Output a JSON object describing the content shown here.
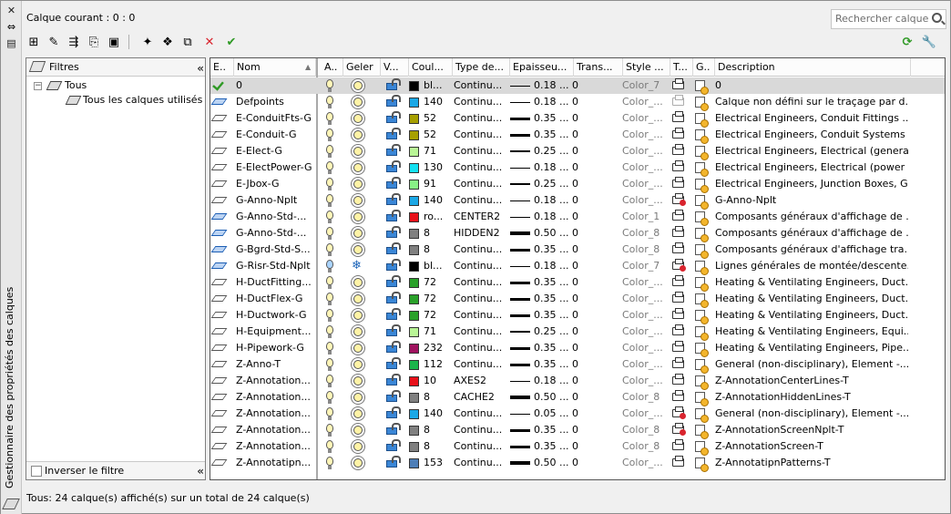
{
  "title": "Gestionnaire des propriétés des calques",
  "current_layer": "Calque courant : 0 : 0",
  "search": {
    "placeholder": "Rechercher calque"
  },
  "filters": {
    "header": "Filtres",
    "tree": [
      {
        "label": "Tous",
        "expanded": true
      },
      {
        "label": "Tous les calques utilisés"
      }
    ],
    "invert_label": "Inverser le filtre"
  },
  "columns": [
    "E..",
    "Nom",
    "A..",
    "Geler",
    "V...",
    "Coul...",
    "Type de...",
    "Epaisseu...",
    "Trans...",
    "Style ...",
    "T...",
    "G..",
    "Description"
  ],
  "rows": [
    {
      "state": "current",
      "name": "0",
      "on": true,
      "freeze": false,
      "color_hex": "#000000",
      "color": "bl...",
      "linetype": "Continu...",
      "lw_label": "0.18 ...",
      "lw": 1,
      "trans": "0",
      "style": "Color_7",
      "plot": "yes",
      "desc": "0"
    },
    {
      "state": "blue",
      "name": "Defpoints",
      "on": true,
      "freeze": false,
      "color_hex": "#1ba8e6",
      "color": "140",
      "linetype": "Continu...",
      "lw_label": "0.18 ...",
      "lw": 1,
      "trans": "0",
      "style": "Color_...",
      "plot": "dim",
      "desc": "Calque non défini sur le traçage par d..."
    },
    {
      "state": "gray",
      "name": "E-ConduitFts-G",
      "on": true,
      "freeze": false,
      "color_hex": "#a7a000",
      "color": "52",
      "linetype": "Continu...",
      "lw_label": "0.35 ...",
      "lw": 3,
      "trans": "0",
      "style": "Color_...",
      "plot": "yes",
      "desc": "Electrical Engineers, Conduit Fittings ..."
    },
    {
      "state": "gray",
      "name": "E-Conduit-G",
      "on": true,
      "freeze": false,
      "color_hex": "#a7a000",
      "color": "52",
      "linetype": "Continu...",
      "lw_label": "0.35 ...",
      "lw": 3,
      "trans": "0",
      "style": "Color_...",
      "plot": "yes",
      "desc": "Electrical Engineers, Conduit Systems ..."
    },
    {
      "state": "gray",
      "name": "E-Elect-G",
      "on": true,
      "freeze": false,
      "color_hex": "#b9f596",
      "color": "71",
      "linetype": "Continu...",
      "lw_label": "0.25 ...",
      "lw": 2,
      "trans": "0",
      "style": "Color_...",
      "plot": "yes",
      "desc": "Electrical Engineers, Electrical (general..."
    },
    {
      "state": "gray",
      "name": "E-ElectPower-G",
      "on": true,
      "freeze": false,
      "color_hex": "#14e1f2",
      "color": "130",
      "linetype": "Continu...",
      "lw_label": "0.18 ...",
      "lw": 1,
      "trans": "0",
      "style": "Color_...",
      "plot": "yes",
      "desc": "Electrical Engineers, Electrical (power ..."
    },
    {
      "state": "gray",
      "name": "E-Jbox-G",
      "on": true,
      "freeze": false,
      "color_hex": "#88f286",
      "color": "91",
      "linetype": "Continu...",
      "lw_label": "0.25 ...",
      "lw": 2,
      "trans": "0",
      "style": "Color_...",
      "plot": "yes",
      "desc": "Electrical Engineers, Junction Boxes, G..."
    },
    {
      "state": "gray",
      "name": "G-Anno-Nplt",
      "on": true,
      "freeze": false,
      "color_hex": "#1ba8e6",
      "color": "140",
      "linetype": "Continu...",
      "lw_label": "0.18 ...",
      "lw": 1,
      "trans": "0",
      "style": "Color_...",
      "plot": "no",
      "desc": "G-Anno-Nplt"
    },
    {
      "state": "blue",
      "name": "G-Anno-Std-...",
      "on": true,
      "freeze": false,
      "color_hex": "#e8111a",
      "color": "ro...",
      "linetype": "CENTER2",
      "lw_label": "0.18 ...",
      "lw": 1,
      "trans": "0",
      "style": "Color_1",
      "plot": "yes",
      "desc": "Composants généraux d'affichage de ..."
    },
    {
      "state": "blue",
      "name": "G-Anno-Std-...",
      "on": true,
      "freeze": false,
      "color_hex": "#808080",
      "color": "8",
      "linetype": "HIDDEN2",
      "lw_label": "0.50 ...",
      "lw": 4,
      "trans": "0",
      "style": "Color_8",
      "plot": "yes",
      "desc": "Composants généraux d'affichage de ..."
    },
    {
      "state": "blue",
      "name": "G-Bgrd-Std-S...",
      "on": true,
      "freeze": false,
      "color_hex": "#808080",
      "color": "8",
      "linetype": "Continu...",
      "lw_label": "0.35 ...",
      "lw": 3,
      "trans": "0",
      "style": "Color_8",
      "plot": "yes",
      "desc": "Composants généraux d'affichage tra..."
    },
    {
      "state": "blue",
      "name": "G-Risr-Std-Nplt",
      "on": false,
      "freeze": true,
      "color_hex": "#000000",
      "color": "bl...",
      "linetype": "Continu...",
      "lw_label": "0.18 ...",
      "lw": 1,
      "trans": "0",
      "style": "Color_7",
      "plot": "no",
      "desc": "Lignes générales de montée/descente..."
    },
    {
      "state": "gray",
      "name": "H-DuctFitting...",
      "on": true,
      "freeze": false,
      "color_hex": "#2aa12a",
      "color": "72",
      "linetype": "Continu...",
      "lw_label": "0.35 ...",
      "lw": 3,
      "trans": "0",
      "style": "Color_...",
      "plot": "yes",
      "desc": "Heating & Ventilating Engineers, Duct..."
    },
    {
      "state": "gray",
      "name": "H-DuctFlex-G",
      "on": true,
      "freeze": false,
      "color_hex": "#2aa12a",
      "color": "72",
      "linetype": "Continu...",
      "lw_label": "0.35 ...",
      "lw": 3,
      "trans": "0",
      "style": "Color_...",
      "plot": "yes",
      "desc": "Heating & Ventilating Engineers, Duct..."
    },
    {
      "state": "gray",
      "name": "H-Ductwork-G",
      "on": true,
      "freeze": false,
      "color_hex": "#2aa12a",
      "color": "72",
      "linetype": "Continu...",
      "lw_label": "0.35 ...",
      "lw": 3,
      "trans": "0",
      "style": "Color_...",
      "plot": "yes",
      "desc": "Heating & Ventilating Engineers, Duct..."
    },
    {
      "state": "gray",
      "name": "H-Equipment...",
      "on": true,
      "freeze": false,
      "color_hex": "#b9f596",
      "color": "71",
      "linetype": "Continu...",
      "lw_label": "0.25 ...",
      "lw": 2,
      "trans": "0",
      "style": "Color_...",
      "plot": "yes",
      "desc": "Heating & Ventilating Engineers, Equi..."
    },
    {
      "state": "gray",
      "name": "H-Pipework-G",
      "on": true,
      "freeze": false,
      "color_hex": "#a0135f",
      "color": "232",
      "linetype": "Continu...",
      "lw_label": "0.35 ...",
      "lw": 3,
      "trans": "0",
      "style": "Color_...",
      "plot": "yes",
      "desc": "Heating & Ventilating Engineers, Pipe..."
    },
    {
      "state": "gray",
      "name": "Z-Anno-T",
      "on": true,
      "freeze": false,
      "color_hex": "#1ab54b",
      "color": "112",
      "linetype": "Continu...",
      "lw_label": "0.35 ...",
      "lw": 3,
      "trans": "0",
      "style": "Color_...",
      "plot": "yes",
      "desc": "General (non-disciplinary), Element -..."
    },
    {
      "state": "gray",
      "name": "Z-Annotation...",
      "on": true,
      "freeze": false,
      "color_hex": "#e8111a",
      "color": "10",
      "linetype": "AXES2",
      "lw_label": "0.18 ...",
      "lw": 1,
      "trans": "0",
      "style": "Color_...",
      "plot": "yes",
      "desc": "Z-AnnotationCenterLines-T"
    },
    {
      "state": "gray",
      "name": "Z-Annotation...",
      "on": true,
      "freeze": false,
      "color_hex": "#808080",
      "color": "8",
      "linetype": "CACHE2",
      "lw_label": "0.50 ...",
      "lw": 4,
      "trans": "0",
      "style": "Color_8",
      "plot": "yes",
      "desc": "Z-AnnotationHiddenLines-T"
    },
    {
      "state": "gray",
      "name": "Z-Annotation...",
      "on": true,
      "freeze": false,
      "color_hex": "#1ba8e6",
      "color": "140",
      "linetype": "Continu...",
      "lw_label": "0.05 ...",
      "lw": 1,
      "trans": "0",
      "style": "Color_...",
      "plot": "no",
      "desc": "General (non-disciplinary), Element -..."
    },
    {
      "state": "gray",
      "name": "Z-Annotation...",
      "on": true,
      "freeze": false,
      "color_hex": "#808080",
      "color": "8",
      "linetype": "Continu...",
      "lw_label": "0.35 ...",
      "lw": 3,
      "trans": "0",
      "style": "Color_8",
      "plot": "no",
      "desc": "Z-AnnotationScreenNplt-T"
    },
    {
      "state": "gray",
      "name": "Z-Annotation...",
      "on": true,
      "freeze": false,
      "color_hex": "#808080",
      "color": "8",
      "linetype": "Continu...",
      "lw_label": "0.35 ...",
      "lw": 3,
      "trans": "0",
      "style": "Color_8",
      "plot": "yes",
      "desc": "Z-AnnotationScreen-T"
    },
    {
      "state": "gray",
      "name": "Z-Annotatipn...",
      "on": true,
      "freeze": false,
      "color_hex": "#4e7fb8",
      "color": "153",
      "linetype": "Continu...",
      "lw_label": "0.50 ...",
      "lw": 4,
      "trans": "0",
      "style": "Color_...",
      "plot": "yes",
      "desc": "Z-AnnotatipnPatterns-T"
    }
  ],
  "status": "Tous: 24 calque(s) affiché(s) sur un total de 24 calque(s)",
  "toolbar_icons": [
    "new-property-filter-icon",
    "new-group-filter-icon",
    "layer-states-icon",
    "layer-states-manager-icon",
    "save-icon",
    "new-layer-icon",
    "new-layer-vp-frozen-icon",
    "delete-layer-icon",
    "delete-icon",
    "set-current-icon"
  ],
  "colors": {
    "accent_check": "#2f9a25",
    "delete_red": "#d9242e",
    "selected_row": "#d9d9d9"
  }
}
